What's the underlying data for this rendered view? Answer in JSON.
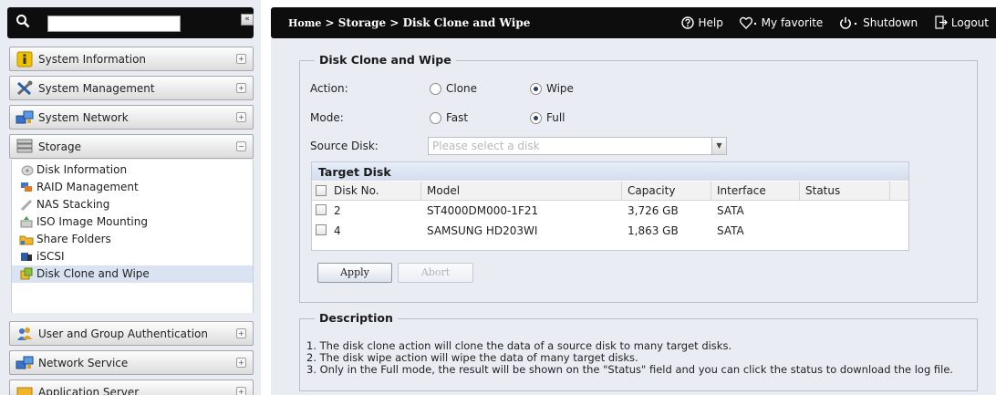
{
  "search": {
    "value": "",
    "placeholder": ""
  },
  "sidebar": {
    "collapse_glyph": "«",
    "toggle_collapsed": "+",
    "toggle_expanded": "−",
    "items": [
      {
        "label": "System Information",
        "icon": "info-icon"
      },
      {
        "label": "System Management",
        "icon": "tools-icon"
      },
      {
        "label": "System Network",
        "icon": "network-icon"
      },
      {
        "label": "Storage",
        "icon": "storage-icon"
      },
      {
        "label": "User and Group Authentication",
        "icon": "users-icon"
      },
      {
        "label": "Network Service",
        "icon": "network-service-icon"
      },
      {
        "label": "Application Server",
        "icon": "app-server-icon"
      }
    ],
    "storage_sub": [
      {
        "label": "Disk Information",
        "icon": "disk-icon"
      },
      {
        "label": "RAID Management",
        "icon": "raid-icon"
      },
      {
        "label": "NAS Stacking",
        "icon": "stacking-icon"
      },
      {
        "label": "ISO Image Mounting",
        "icon": "iso-icon"
      },
      {
        "label": "Share Folders",
        "icon": "folder-icon"
      },
      {
        "label": "iSCSI",
        "icon": "iscsi-icon"
      },
      {
        "label": "Disk Clone and Wipe",
        "icon": "clone-icon"
      }
    ]
  },
  "header": {
    "breadcrumb": [
      "Home",
      "Storage",
      "Disk Clone and Wipe"
    ],
    "separator": " > ",
    "links": {
      "help": "Help",
      "favorite": "My favorite",
      "shutdown": "Shutdown",
      "logout": "Logout"
    }
  },
  "form": {
    "legend": "Disk Clone and Wipe",
    "action_label": "Action:",
    "action_options": [
      "Clone",
      "Wipe"
    ],
    "action_selected": "Wipe",
    "mode_label": "Mode:",
    "mode_options": [
      "Fast",
      "Full"
    ],
    "mode_selected": "Full",
    "source_label": "Source Disk:",
    "source_value": "Please select a disk"
  },
  "target": {
    "title": "Target Disk",
    "columns": [
      "Disk No.",
      "Model",
      "Capacity",
      "Interface",
      "Status"
    ],
    "rows": [
      {
        "disk_no": "2",
        "model": "ST4000DM000-1F21",
        "capacity": "3,726 GB",
        "interface": "SATA",
        "status": ""
      },
      {
        "disk_no": "4",
        "model": "SAMSUNG HD203WI",
        "capacity": "1,863 GB",
        "interface": "SATA",
        "status": ""
      }
    ]
  },
  "buttons": {
    "apply": "Apply",
    "abort": "Abort"
  },
  "description": {
    "legend": "Description",
    "lines": [
      "1. The disk clone action will clone the data of a source disk to many target disks.",
      "2. The disk wipe action will wipe the data of many target disks.",
      "3. Only in the Full mode, the result will be shown on the \"Status\" field and you can click the status to download the log file."
    ]
  },
  "colors": {
    "bar": "#0d0d0d",
    "panel": "#e9edf3",
    "active_item": "#d9e3f2",
    "table_header": "#d3ddee"
  }
}
